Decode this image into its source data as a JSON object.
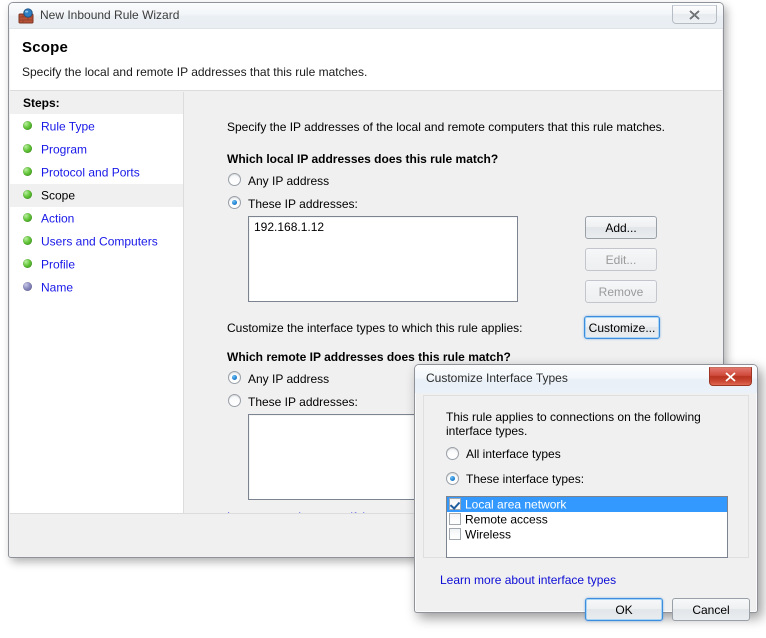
{
  "wizard": {
    "title": "New Inbound Rule Wizard",
    "title_icon": "firewall-brick-icon",
    "close_icon": "close-icon",
    "page_title": "Scope",
    "page_subtitle": "Specify the local and remote IP addresses that this rule matches.",
    "steps_header": "Steps:",
    "steps": [
      {
        "label": "Rule Type",
        "state": "done"
      },
      {
        "label": "Program",
        "state": "done"
      },
      {
        "label": "Protocol and Ports",
        "state": "done"
      },
      {
        "label": "Scope",
        "state": "current"
      },
      {
        "label": "Action",
        "state": "done"
      },
      {
        "label": "Users and Computers",
        "state": "done"
      },
      {
        "label": "Profile",
        "state": "done"
      },
      {
        "label": "Name",
        "state": "pending"
      }
    ],
    "content": {
      "intro": "Specify the IP addresses of the local and remote computers that this rule matches.",
      "local": {
        "question": "Which local IP addresses does this rule match?",
        "option_any": "Any IP address",
        "option_these": "These IP addresses:",
        "selected": "these",
        "addresses": [
          "192.168.1.12"
        ],
        "add_label": "Add...",
        "edit_label": "Edit...",
        "remove_label": "Remove"
      },
      "interface": {
        "label": "Customize the interface types to which this rule applies:",
        "button_label": "Customize..."
      },
      "remote": {
        "question": "Which remote IP addresses does this rule match?",
        "option_any": "Any IP address",
        "option_these": "These IP addresses:",
        "selected": "any",
        "addresses": []
      },
      "learn_more": "Learn more about specifying scope"
    }
  },
  "modal": {
    "title": "Customize Interface Types",
    "close_icon": "close-icon",
    "description": "This rule applies to connections on the following interface types.",
    "option_all": "All interface types",
    "option_these": "These interface types:",
    "selected": "these",
    "interface_types": [
      {
        "label": "Local area network",
        "checked": true,
        "selected": true
      },
      {
        "label": "Remote access",
        "checked": false,
        "selected": false
      },
      {
        "label": "Wireless",
        "checked": false,
        "selected": false
      }
    ],
    "learn_more": "Learn more about interface types",
    "ok_label": "OK",
    "cancel_label": "Cancel"
  },
  "colors": {
    "accent_blue": "#3399ff",
    "link_blue": "#0d0dd6",
    "step_blue": "#1717e8",
    "close_red": "#b8321f",
    "dialog_bg": "#f0f0f0"
  }
}
